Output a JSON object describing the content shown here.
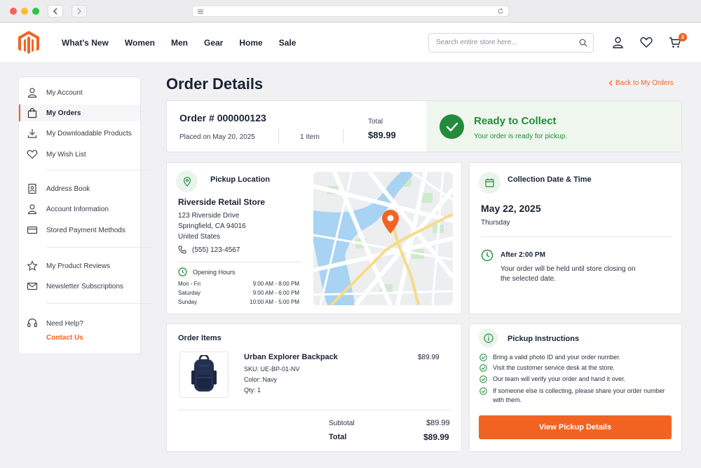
{
  "colors": {
    "accent": "#f26322",
    "success": "#238b3b",
    "text": "#1a2236"
  },
  "header": {
    "nav": [
      "What's New",
      "Women",
      "Men",
      "Gear",
      "Home",
      "Sale"
    ],
    "search_placeholder": "Search entire store here...",
    "cart_count": "2"
  },
  "sidebar": {
    "items": [
      {
        "label": "My Account",
        "icon": "user-icon"
      },
      {
        "label": "My Orders",
        "icon": "bag-icon",
        "active": true
      },
      {
        "label": "My Downloadable Products",
        "icon": "download-icon"
      },
      {
        "label": "My Wish List",
        "icon": "heart-icon"
      },
      {
        "label": "Address Book",
        "icon": "address-book-icon"
      },
      {
        "label": "Account Information",
        "icon": "user-icon"
      },
      {
        "label": "Stored Payment Methods",
        "icon": "credit-card-icon"
      },
      {
        "label": "My Product Reviews",
        "icon": "star-icon"
      },
      {
        "label": "Newsletter Subscriptions",
        "icon": "mail-icon"
      }
    ],
    "help_label": "Need Help?",
    "help_link": "Contact Us"
  },
  "main": {
    "title": "Order Details",
    "back_link": "Back to My Orders",
    "order": {
      "number": "Order # 000000123",
      "placed": "Placed on May 20, 2025",
      "items": "1 Item",
      "total_label": "Total",
      "total_value": "$89.99"
    },
    "status": {
      "title": "Ready to Collect",
      "subtitle": "Your order is ready for pickup."
    },
    "pickup": {
      "title": "Pickup Location",
      "store_name": "Riverside Retail Store",
      "address": [
        "123 Riverside Drive",
        "Springfield, CA 94016",
        "United States"
      ],
      "phone": "(555) 123-4567",
      "hours_title": "Opening Hours",
      "hours": [
        {
          "day": "Mon - Fri",
          "time": "9:00 AM - 8:00 PM"
        },
        {
          "day": "Saturday",
          "time": "9:00 AM - 6:00 PM"
        },
        {
          "day": "Sunday",
          "time": "10:00 AM - 5:00 PM"
        }
      ]
    },
    "collection": {
      "title": "Collection Date & Time",
      "date": "May 22, 2025",
      "day": "Thursday",
      "time": "After 2:00 PM",
      "note": "Your order will be held until store closing on the selected date."
    },
    "items": {
      "title": "Order Items",
      "product": {
        "name": "Urban Explorer Backpack",
        "sku": "SKU: UE-BP-01-NV",
        "color": "Color:  Navy",
        "qty": "Qty:  1",
        "price": "$89.99"
      },
      "subtotal_label": "Subtotal",
      "subtotal_value": "$89.99",
      "total_label": "Total",
      "total_value": "$89.99"
    },
    "instructions": {
      "title": "Pickup Instructions",
      "steps": [
        "Bring a valid photo ID and your order number.",
        "Visit the customer service desk at the store.",
        "Our team will verify your order and hand it over.",
        "If someone else is collecting, please share your order number with them."
      ],
      "button": "View Pickup Details"
    }
  }
}
